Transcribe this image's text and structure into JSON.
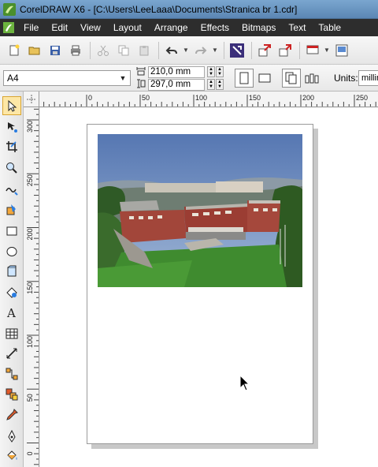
{
  "window": {
    "title": "CorelDRAW X6 - [C:\\Users\\LeeLaaa\\Documents\\Stranica br 1.cdr]"
  },
  "menu": {
    "items": [
      "File",
      "Edit",
      "View",
      "Layout",
      "Arrange",
      "Effects",
      "Bitmaps",
      "Text",
      "Table"
    ]
  },
  "property_bar": {
    "page_size": "A4",
    "width_value": "210,0 mm",
    "height_value": "297,0 mm",
    "units_label": "Units:",
    "units_value": "millim"
  },
  "ruler": {
    "h_labels": [
      "0",
      "50",
      "100",
      "150",
      "200",
      "250"
    ],
    "v_labels": [
      "300",
      "250",
      "200",
      "150",
      "100",
      "50",
      "0"
    ]
  },
  "colors": {
    "menubar_bg": "#2d2d2d",
    "titlebar_bg": "#6f9bc6",
    "active_tool": "#fde7a6"
  }
}
